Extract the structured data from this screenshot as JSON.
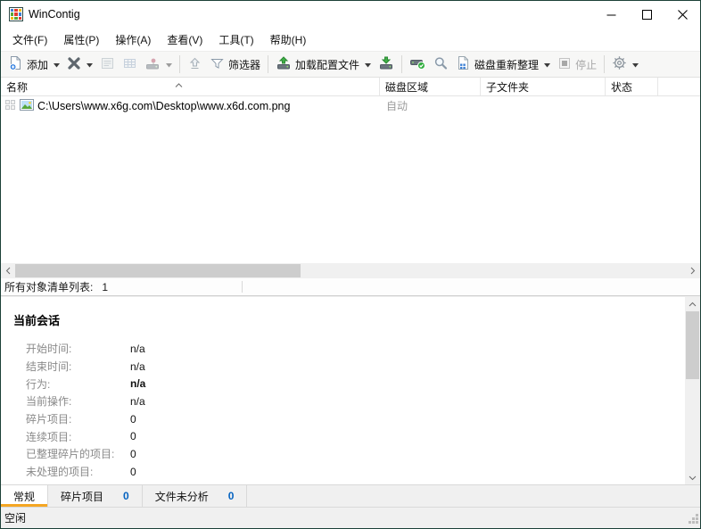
{
  "window": {
    "title": "WinContig"
  },
  "menu": {
    "items": [
      "文件(F)",
      "属性(P)",
      "操作(A)",
      "查看(V)",
      "工具(T)",
      "帮助(H)"
    ]
  },
  "toolbar": {
    "add_label": "添加",
    "filter_label": "筛选器",
    "load_profile_label": "加载配置文件",
    "defragment_label": "磁盘重新整理",
    "stop_label": "停止"
  },
  "list": {
    "columns": [
      "名称",
      "磁盘区域",
      "子文件夹",
      "状态"
    ],
    "row": {
      "path": "C:\\Users\\www.x6g.com\\Desktop\\www.x6d.com.png",
      "disk_area": "自动"
    }
  },
  "count_bar": {
    "text": "所有对象清单列表:",
    "value": "1"
  },
  "session": {
    "title": "当前会话",
    "fields": [
      {
        "label": "开始时间:",
        "value": "n/a"
      },
      {
        "label": "结束时间:",
        "value": "n/a"
      },
      {
        "label": "行为:",
        "value": "n/a"
      },
      {
        "label": "当前操作:",
        "value": "n/a"
      },
      {
        "label": "碎片项目:",
        "value": "0"
      },
      {
        "label": "连续项目:",
        "value": "0"
      },
      {
        "label": "已整理碎片的项目:",
        "value": "0"
      },
      {
        "label": "未处理的项目:",
        "value": "0"
      }
    ]
  },
  "tabs": [
    {
      "label": "常规",
      "count": ""
    },
    {
      "label": "碎片项目",
      "count": "0"
    },
    {
      "label": "文件未分析",
      "count": "0"
    }
  ],
  "status_bar": {
    "text": "空闲"
  },
  "colors": {
    "accent_orange": "#F5A623",
    "count_blue": "#0563C1",
    "frame": "#1C4038",
    "disabled_text": "#A9A9A9"
  }
}
